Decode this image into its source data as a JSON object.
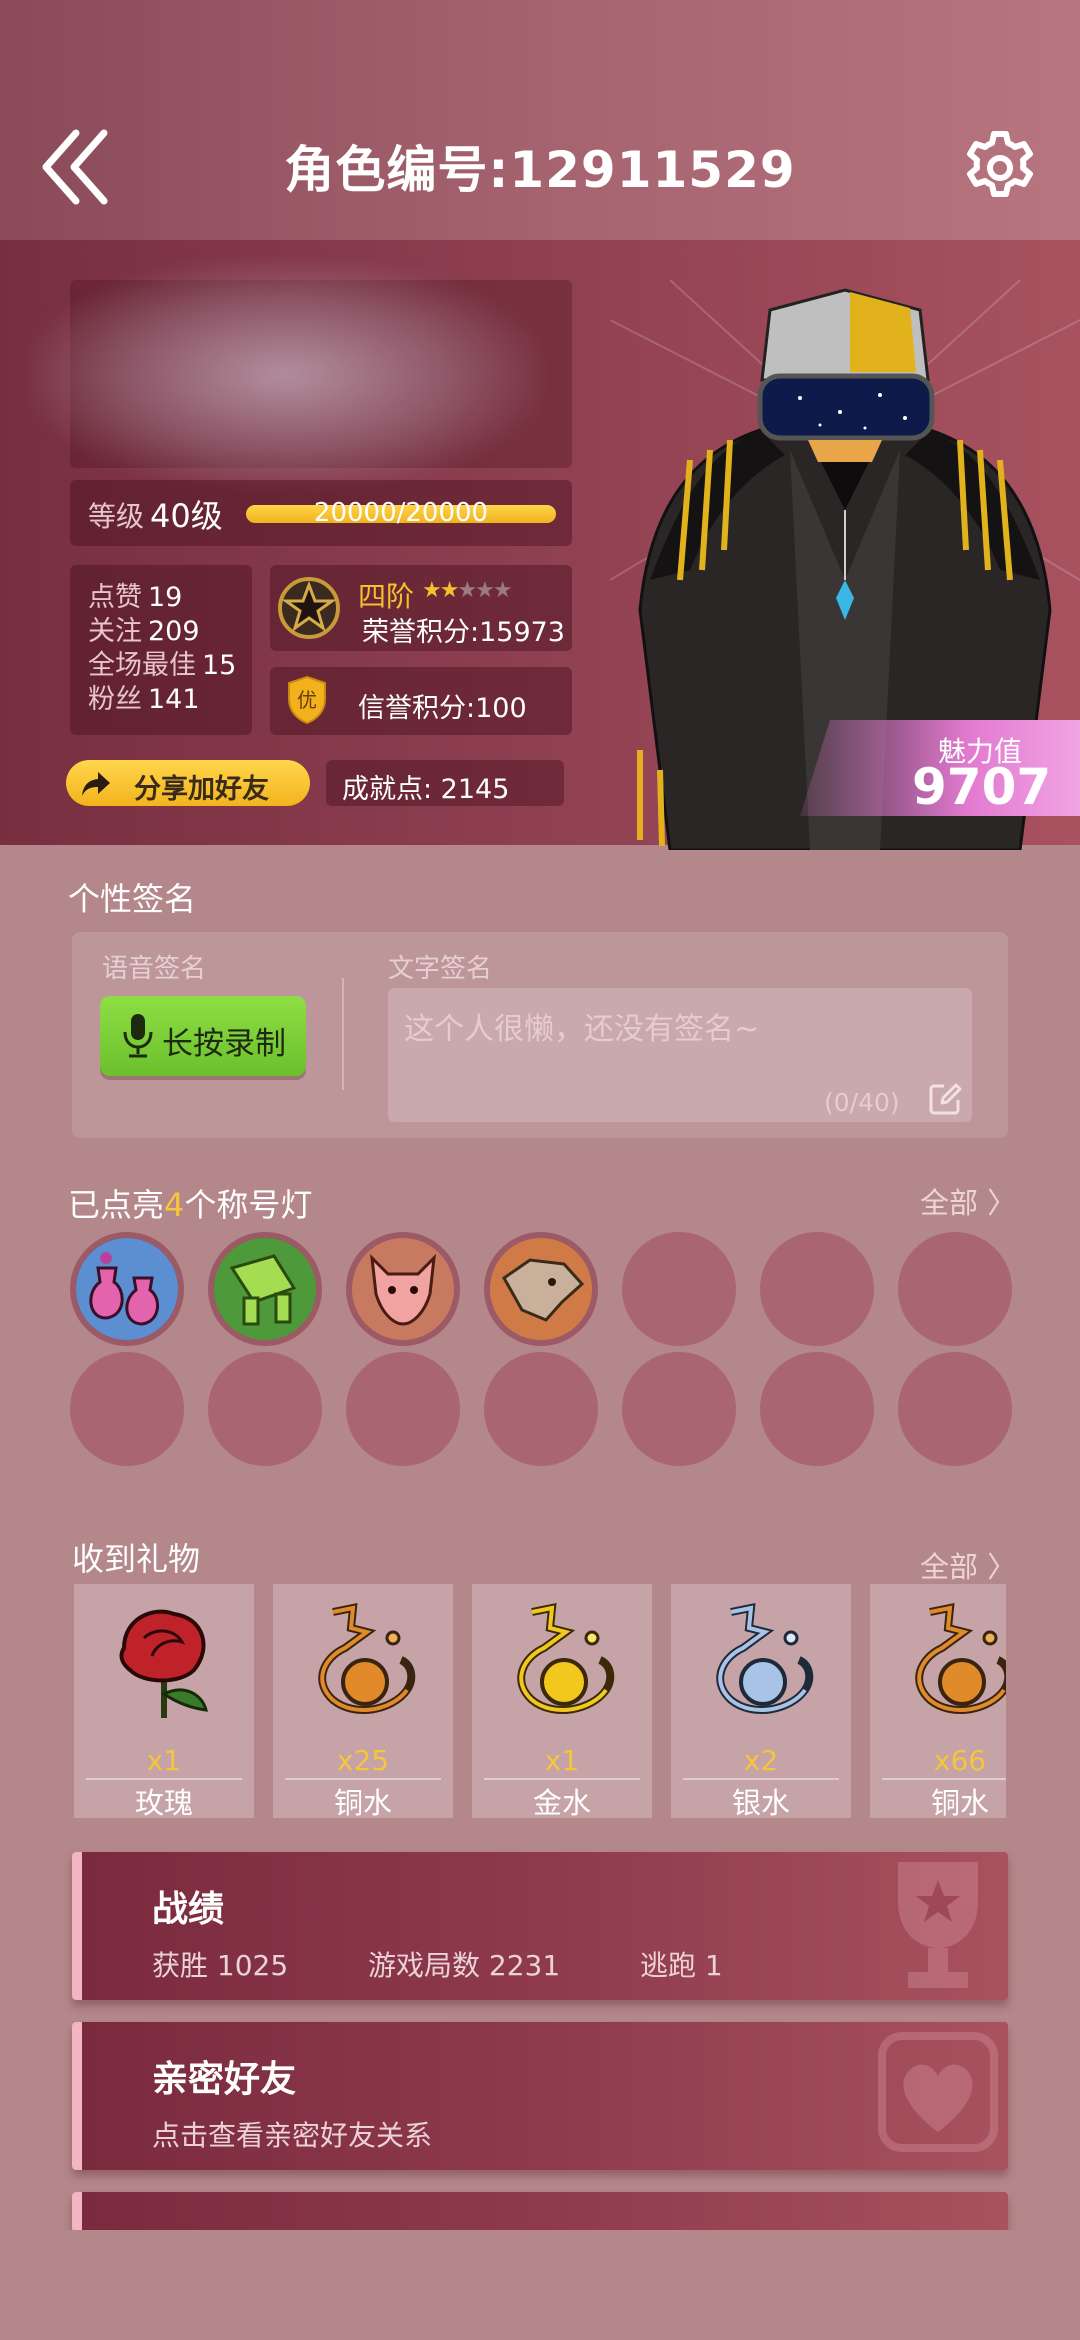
{
  "header": {
    "title": "角色编号:12911529"
  },
  "profile": {
    "level_label": "等级",
    "level_value": "40级",
    "level_progress": "20000/20000",
    "level_fill": 1.0,
    "stats": [
      {
        "label": "点赞",
        "value": "19"
      },
      {
        "label": "关注",
        "value": "209"
      },
      {
        "label": "全场最佳",
        "value": "15"
      },
      {
        "label": "粉丝",
        "value": "141"
      }
    ],
    "rank_name": "四阶",
    "rank_stars_filled": 2,
    "rank_stars_total": 5,
    "honor_points": "荣誉积分:15973",
    "credit_badge": "优",
    "credit_points": "信誉积分:100",
    "share_label": "分享加好友",
    "achievement": "成就点: 2145",
    "charm_label": "魅力值",
    "charm_value": "9707"
  },
  "signature": {
    "section_title": "个性签名",
    "voice_label": "语音签名",
    "text_label": "文字签名",
    "record_button": "长按录制",
    "placeholder": "这个人很懒，还没有签名~",
    "count": "(0/40)"
  },
  "title_lights": {
    "prefix": "已点亮",
    "count": "4",
    "suffix": "个称号灯",
    "all_label": "全部 〉",
    "lit": [
      {
        "icon": "potion-bottles-icon",
        "color": "#d2539a"
      },
      {
        "icon": "green-cannon-icon",
        "color": "#8ec43a"
      },
      {
        "icon": "red-wolf-icon",
        "color": "#d9806c"
      },
      {
        "icon": "grey-wolf-icon",
        "color": "#b99b86"
      }
    ],
    "total_slots": 14
  },
  "gifts": {
    "section_title": "收到礼物",
    "all_label": "全部 〉",
    "items": [
      {
        "icon": "rose-icon",
        "count": "x1",
        "name": "玫瑰",
        "color": "#c0392b"
      },
      {
        "icon": "copper-water-icon",
        "count": "x25",
        "name": "铜水",
        "color": "#e08a2a"
      },
      {
        "icon": "gold-water-icon",
        "count": "x1",
        "name": "金水",
        "color": "#f2c81e"
      },
      {
        "icon": "silver-water-icon",
        "count": "x2",
        "name": "银水",
        "color": "#a9c3e6"
      },
      {
        "icon": "copper-water-icon",
        "count": "x66",
        "name": "铜水",
        "color": "#e08a2a"
      }
    ]
  },
  "record_card": {
    "title": "战绩",
    "wins": "获胜 1025",
    "games": "游戏局数 2231",
    "escapes": "逃跑 1"
  },
  "friends_card": {
    "title": "亲密好友",
    "subtitle": "点击查看亲密好友关系"
  }
}
